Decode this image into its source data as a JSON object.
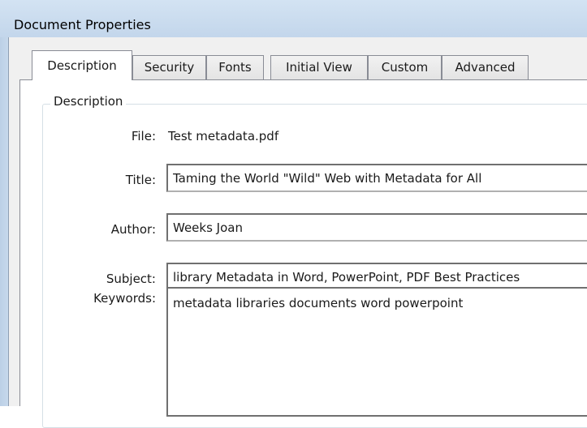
{
  "window": {
    "title": "Document Properties"
  },
  "tabs": [
    {
      "label": "Description",
      "active": true
    },
    {
      "label": "Security",
      "active": false
    },
    {
      "label": "Fonts",
      "active": false
    },
    {
      "label": "Initial View",
      "active": false
    },
    {
      "label": "Custom",
      "active": false
    },
    {
      "label": "Advanced",
      "active": false
    }
  ],
  "description_group": {
    "legend": "Description",
    "file": {
      "label": "File:",
      "value": "Test metadata.pdf"
    },
    "title": {
      "label": "Title:",
      "value": "Taming the World \"Wild\" Web with Metadata for All"
    },
    "author": {
      "label": "Author:",
      "value": "Weeks Joan"
    },
    "subject": {
      "label": "Subject:",
      "value": "library Metadata in Word, PowerPoint, PDF Best Practices"
    },
    "keywords": {
      "label": "Keywords:",
      "value": "metadata libraries documents word powerpoint"
    }
  },
  "colors": {
    "titlebar": "#c8dbef",
    "dialog_background": "#f0f0f0",
    "panel_background": "#ffffff",
    "border": "#898c95"
  }
}
